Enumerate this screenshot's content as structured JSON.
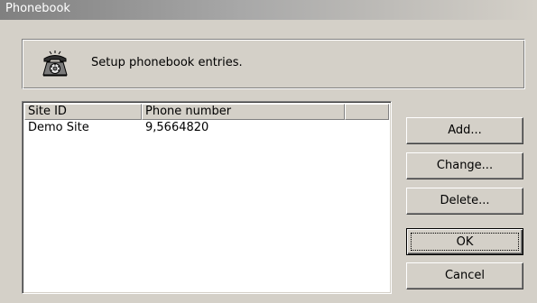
{
  "window": {
    "title": "Phonebook"
  },
  "header": {
    "icon": "telephone-icon",
    "text": "Setup phonebook entries."
  },
  "list": {
    "columns": [
      "Site ID",
      "Phone number",
      ""
    ],
    "rows": [
      {
        "site_id": "Demo Site",
        "phone": "9,5664820"
      }
    ]
  },
  "buttons": {
    "add": "Add...",
    "change": "Change...",
    "delete": "Delete...",
    "ok": "OK",
    "cancel": "Cancel"
  },
  "colors": {
    "face": "#d4d0c8",
    "shadow": "#808080",
    "highlight": "#ffffff"
  }
}
